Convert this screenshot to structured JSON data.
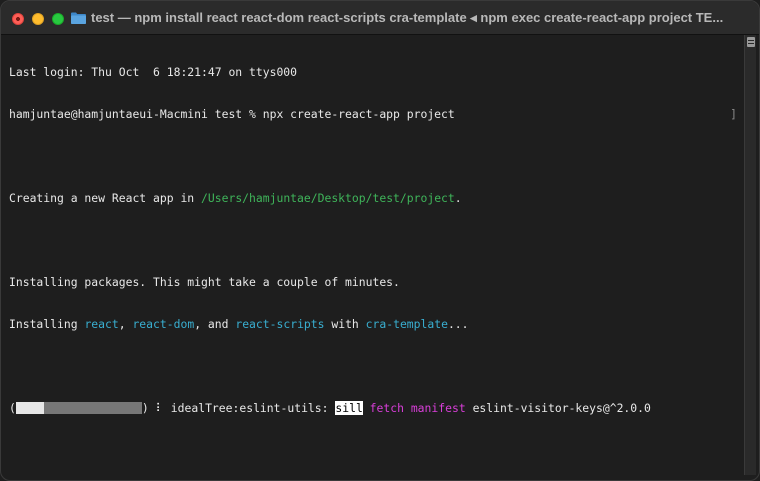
{
  "window": {
    "title": "test — npm install react react-dom react-scripts cra-template ◂ npm exec create-react-app project TE...",
    "folder_icon": "folder-icon"
  },
  "terminal": {
    "last_login": "Last login: Thu Oct  6 18:21:47 on ttys000",
    "prompt": "hamjuntae@hamjuntaeui-Macmini test % npx create-react-app project",
    "prompt_end_mark": "]",
    "creating_prefix": "Creating a new React app in ",
    "creating_path": "/Users/hamjuntae/Desktop/test/project",
    "creating_suffix": ".",
    "installing_line1": "Installing packages. This might take a couple of minutes.",
    "install2_prefix": "Installing ",
    "pkg_react": "react",
    "sep_comma1": ", ",
    "pkg_react_dom": "react-dom",
    "sep_and": ", and ",
    "pkg_react_scripts": "react-scripts",
    "sep_with": " with ",
    "pkg_cra_template": "cra-template",
    "install2_suffix": "...",
    "progress_open": "(",
    "progress_fraction": 0.22,
    "progress_close": ")",
    "spinner": "⠇",
    "task": " idealTree:eslint-utils: ",
    "log_level": "sill",
    "log_fetch": "fetch",
    "log_manifest": "manifest",
    "log_package": "eslint-visitor-keys@^2.0.0"
  },
  "colors": {
    "path_green": "#3fb45a",
    "package_cyan": "#39aed0",
    "npm_magenta": "#d83ed8"
  }
}
